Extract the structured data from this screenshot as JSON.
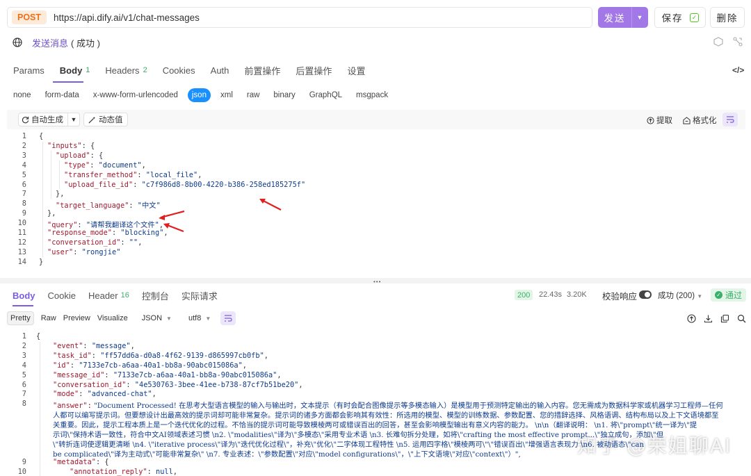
{
  "request": {
    "method": "POST",
    "url": "https://api.dify.ai/v1/chat-messages",
    "send_label": "发送",
    "save_label": "保存",
    "delete_label": "删除",
    "name": "发送消息",
    "status": "( 成功 )"
  },
  "req_tabs": [
    {
      "label": "Params",
      "count": ""
    },
    {
      "label": "Body",
      "count": "1"
    },
    {
      "label": "Headers",
      "count": "2"
    },
    {
      "label": "Cookies",
      "count": ""
    },
    {
      "label": "Auth",
      "count": ""
    },
    {
      "label": "前置操作",
      "count": ""
    },
    {
      "label": "后置操作",
      "count": ""
    },
    {
      "label": "设置",
      "count": ""
    }
  ],
  "body_types": [
    "none",
    "form-data",
    "x-www-form-urlencoded",
    "json",
    "xml",
    "raw",
    "binary",
    "GraphQL",
    "msgpack"
  ],
  "editor_toolbar": {
    "auto_generate": "自动生成",
    "dynamic_value": "动态值",
    "extract": "提取",
    "format": "格式化"
  },
  "request_body_lines": [
    "{",
    "\"inputs\": {",
    "\"upload\": {",
    "\"type\": \"document\",",
    "\"transfer_method\": \"local_file\",",
    "\"upload_file_id\": \"c7f986d8-8b00-4220-b386-258ed185275f\"",
    "},",
    "\"target_language\": \"中文\"",
    "},",
    "\"query\": \"请帮我翻译这个文件\",",
    "\"response_mode\": \"blocking\",",
    "\"conversation_id\": \"\",",
    "\"user\": \"rongjie\"",
    "}"
  ],
  "resp_tabs": [
    {
      "label": "Body",
      "count": ""
    },
    {
      "label": "Cookie",
      "count": ""
    },
    {
      "label": "Header",
      "count": "16"
    },
    {
      "label": "控制台",
      "count": ""
    },
    {
      "label": "实际请求",
      "count": ""
    }
  ],
  "resp_meta": {
    "status_code": "200",
    "time": "22.43s",
    "size": "3.20K",
    "validate_label": "校验响应",
    "success_select": "成功 (200)",
    "pass_label": "通过"
  },
  "view_bar": {
    "modes": [
      "Pretty",
      "Raw",
      "Preview",
      "Visualize"
    ],
    "format": "JSON",
    "encoding": "utf8"
  },
  "response_lines": [
    "{",
    "\"event\": \"message\",",
    "\"task_id\": \"ff57dd6a-d0a8-4f62-9139-d865997cb0fb\",",
    "\"id\": \"7133e7cb-a6aa-40a1-bb8a-90abc015086a\",",
    "\"message_id\": \"7133e7cb-a6aa-40a1-bb8a-90abc015086a\",",
    "\"conversation_id\": \"4e530763-3bee-41ee-b738-87cf7b51be20\",",
    "\"mode\": \"advanced-chat\","
  ],
  "answer_lines": [
    "\"answer\": \"Document Processed! 在思考大型语言模型的输入与输出时，文本提示（有时会配合图像提示等多模态输入）是模型用于预测特定输出的输入内容。您无需成为数据科学家或机器学习工程师—任何",
    "人都可以编写提示词。但要想设计出最高效的提示词却可能非常复杂。提示词的诸多方面都会影响其有效性：所选用的模型、模型的训练数据、参数配置、您的措辞选择、风格语调、结构布局以及上下文语境都至",
    "关重要。因此，提示工程本质上是一个迭代优化的过程。不恰当的提示词可能导致模棱两可或错误百出的回答，甚至会影响模型输出有意义内容的能力。    \\n\\n（翻译说明：   \\n1. 将\\\"prompt\\\"统一译为\\\"提",
    "示词\\\"保持术语一致性，符合中文AI领域表述习惯   \\n2. \\\"modalities\\\"译为\\\"多模态\\\"采用专业术语   \\n3. 长难句拆分处理，如将\\\"crafting the most effective prompt...\\\"独立成句，添加\\\"但",
    "\\\"转折连词使逻辑更清晰   \\n4. \\\"iterative process\\\"译为\\\"迭代优化过程\\\"，补充\\\"优化\\\"二字体现工程特性   \\n5. 运用四字格\\\"模棱两可\\\"\\\"错误百出\\\"增强语言表现力   \\n6. 被动语态\\\"can",
    "be complicated\\\"译为主动式\\\"可能非常复杂\\\"   \\n7. 专业表述：\\\"参数配置\\\"对应\\\"model configurations\\\"，\\\"上下文语境\\\"对应\\\"context\\\"）\","
  ],
  "response_tail_lines": [
    "\"metadata\": {",
    "\"annotation_reply\": null,"
  ],
  "watermark": "知乎 @荣姐聊AI"
}
